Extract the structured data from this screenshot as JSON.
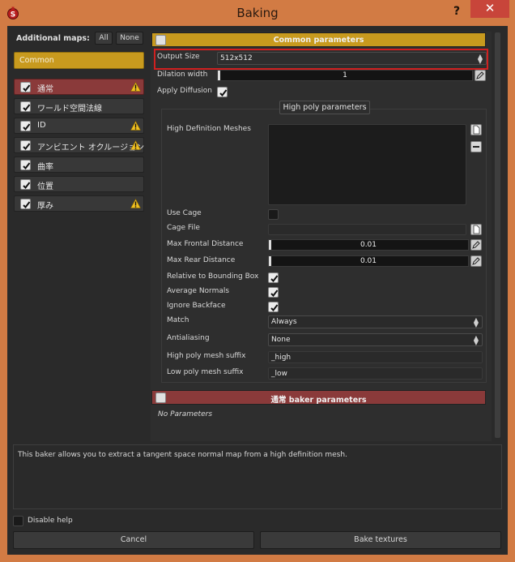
{
  "window": {
    "title": "Baking",
    "help": "?",
    "close": "✕"
  },
  "left": {
    "additional_maps_label": "Additional maps:",
    "all_label": "All",
    "none_label": "None",
    "common_label": "Common",
    "maps": [
      {
        "label": "通常",
        "warning": true,
        "active": true
      },
      {
        "label": "ワールド空間法線",
        "warning": false,
        "active": false
      },
      {
        "label": "ID",
        "warning": true,
        "active": false
      },
      {
        "label": "アンビエント オクルージョン",
        "warning": true,
        "active": false
      },
      {
        "label": "曲率",
        "warning": false,
        "active": false
      },
      {
        "label": "位置",
        "warning": false,
        "active": false
      },
      {
        "label": "厚み",
        "warning": true,
        "active": false
      }
    ]
  },
  "common": {
    "header": "Common parameters",
    "output_size_label": "Output Size",
    "output_size_value": "512x512",
    "dilation_label": "Dilation width",
    "dilation_value": "1",
    "apply_diffusion_label": "Apply Diffusion"
  },
  "high_poly": {
    "tab_label": "High poly parameters",
    "hd_meshes_label": "High Definition Meshes",
    "use_cage_label": "Use Cage",
    "cage_file_label": "Cage File",
    "max_frontal_label": "Max Frontal Distance",
    "max_frontal_value": "0.01",
    "max_rear_label": "Max Rear Distance",
    "max_rear_value": "0.01",
    "relative_bbox_label": "Relative to Bounding Box",
    "average_normals_label": "Average Normals",
    "ignore_backface_label": "Ignore Backface",
    "match_label": "Match",
    "match_value": "Always",
    "antialiasing_label": "Antialiasing",
    "antialiasing_value": "None",
    "hp_suffix_label": "High poly mesh suffix",
    "hp_suffix_value": "_high",
    "lp_suffix_label": "Low poly mesh suffix",
    "lp_suffix_value": "_low"
  },
  "baker": {
    "header": "通常 baker parameters",
    "no_params": "No Parameters"
  },
  "help_text": "This baker allows you to extract a tangent space normal map from a high definition mesh.",
  "disable_help_label": "Disable help",
  "cancel_label": "Cancel",
  "bake_label": "Bake textures",
  "colors": {
    "accent_yellow": "#c89a1e",
    "accent_red": "#8a3a3a",
    "frame": "#d27b44",
    "highlight_outline": "#d02020"
  }
}
